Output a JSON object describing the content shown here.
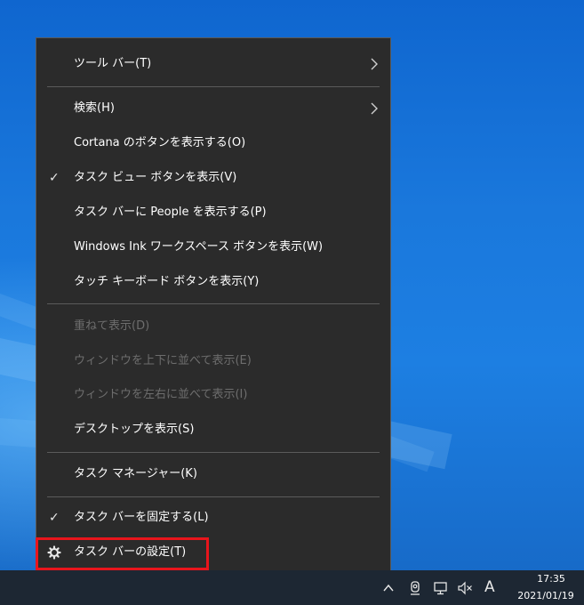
{
  "menu": {
    "items": [
      {
        "label": "ツール バー(T)",
        "submenu": true,
        "checked": false,
        "enabled": true
      },
      {
        "label": "検索(H)",
        "submenu": true,
        "checked": false,
        "enabled": true
      },
      {
        "label": "Cortana のボタンを表示する(O)",
        "submenu": false,
        "checked": false,
        "enabled": true
      },
      {
        "label": "タスク ビュー ボタンを表示(V)",
        "submenu": false,
        "checked": true,
        "enabled": true
      },
      {
        "label": "タスク バーに People を表示する(P)",
        "submenu": false,
        "checked": false,
        "enabled": true
      },
      {
        "label": "Windows Ink ワークスペース ボタンを表示(W)",
        "submenu": false,
        "checked": false,
        "enabled": true
      },
      {
        "label": "タッチ キーボード ボタンを表示(Y)",
        "submenu": false,
        "checked": false,
        "enabled": true
      },
      {
        "label": "重ねて表示(D)",
        "submenu": false,
        "checked": false,
        "enabled": false
      },
      {
        "label": "ウィンドウを上下に並べて表示(E)",
        "submenu": false,
        "checked": false,
        "enabled": false
      },
      {
        "label": "ウィンドウを左右に並べて表示(I)",
        "submenu": false,
        "checked": false,
        "enabled": false
      },
      {
        "label": "デスクトップを表示(S)",
        "submenu": false,
        "checked": false,
        "enabled": true
      },
      {
        "label": "タスク マネージャー(K)",
        "submenu": false,
        "checked": false,
        "enabled": true
      },
      {
        "label": "タスク バーを固定する(L)",
        "submenu": false,
        "checked": true,
        "enabled": true
      },
      {
        "label": "タスク バーの設定(T)",
        "submenu": false,
        "checked": false,
        "enabled": true,
        "icon": "gear-icon"
      }
    ],
    "check_glyph": "✓"
  },
  "taskbar": {
    "tray_icons": [
      "chevron-up-icon",
      "camera-icon",
      "network-icon",
      "volume-muted-icon"
    ],
    "ime_indicator": "A",
    "time": "17:35",
    "date": "2021/01/19"
  },
  "colors": {
    "menu_bg": "#2b2b2b",
    "menu_text": "#ffffff",
    "menu_disabled_text": "#6d6d6d",
    "highlight": "#e8151c",
    "taskbar_bg": "#1d2733",
    "desktop": "#1a78d6"
  }
}
